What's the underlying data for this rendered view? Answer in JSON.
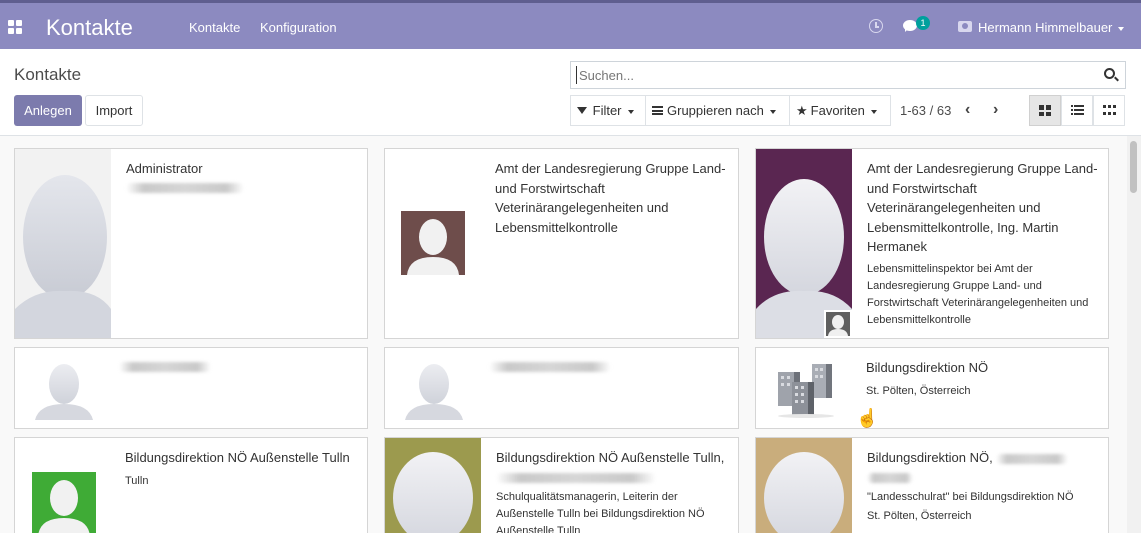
{
  "navbar": {
    "brand": "Kontakte",
    "menu": [
      "Kontakte",
      "Konfiguration"
    ],
    "chat_count": "1",
    "user": "Hermann Himmelbauer",
    "accent_color": "#8c8ac0"
  },
  "control": {
    "title": "Kontakte",
    "create_label": "Anlegen",
    "import_label": "Import",
    "search_placeholder": "Suchen...",
    "filter_label": "Filter",
    "group_label": "Gruppieren nach",
    "favorites_label": "Favoriten",
    "pager": "1-63 / 63",
    "active_view": "kanban",
    "views": [
      "kanban-view-icon",
      "list-view-icon",
      "grid-view-icon"
    ]
  },
  "cards": [
    {
      "name": "Administrator",
      "lines": [],
      "image": "silhouette-large",
      "redacted_lines": 1
    },
    {
      "name": "Amt der Landesregierung Gruppe Land- und Forstwirtschaft Veterinärangelegenheiten und Lebensmittelkontrolle",
      "lines": [],
      "image": "silhouette-small-brown",
      "redacted_lines": 0
    },
    {
      "name": "Amt der Landesregierung Gruppe Land- und Forstwirtschaft Veterinärangelegenheiten und Lebensmittelkontrolle, Ing. Martin Hermanek",
      "lines": [
        "Lebensmittelinspektor bei Amt der Landesregierung Gruppe Land- und Forstwirtschaft Veterinärangelegenheiten und Lebensmittelkontrolle"
      ],
      "image": "silhouette-large-purple",
      "redacted_lines": 0
    },
    {
      "name": "",
      "lines": [],
      "image": "silhouette-small",
      "redacted_lines": 1
    },
    {
      "name": "",
      "lines": [],
      "image": "silhouette-small",
      "redacted_lines": 1
    },
    {
      "name": "Bildungsdirektion NÖ",
      "lines": [
        "St. Pölten, Österreich"
      ],
      "image": "company-buildings-icon",
      "redacted_lines": 0
    },
    {
      "name": "Bildungsdirektion NÖ Außenstelle Tulln",
      "lines": [
        "Tulln"
      ],
      "image": "silhouette-small-green",
      "redacted_lines": 0
    },
    {
      "name": "Bildungsdirektion NÖ Außenstelle Tulln,",
      "lines": [
        "Schulqualitätsmanagerin, Leiterin der Außenstelle Tulln bei Bildungsdirektion NÖ Außenstelle Tulln"
      ],
      "image": "silhouette-large-olive",
      "redacted_lines": 1
    },
    {
      "name": "Bildungsdirektion NÖ,",
      "lines": [
        "\"Landesschulrat\" bei Bildungsdirektion NÖ",
        "St. Pölten, Österreich"
      ],
      "image": "silhouette-large-tan",
      "redacted_lines": 1
    }
  ]
}
